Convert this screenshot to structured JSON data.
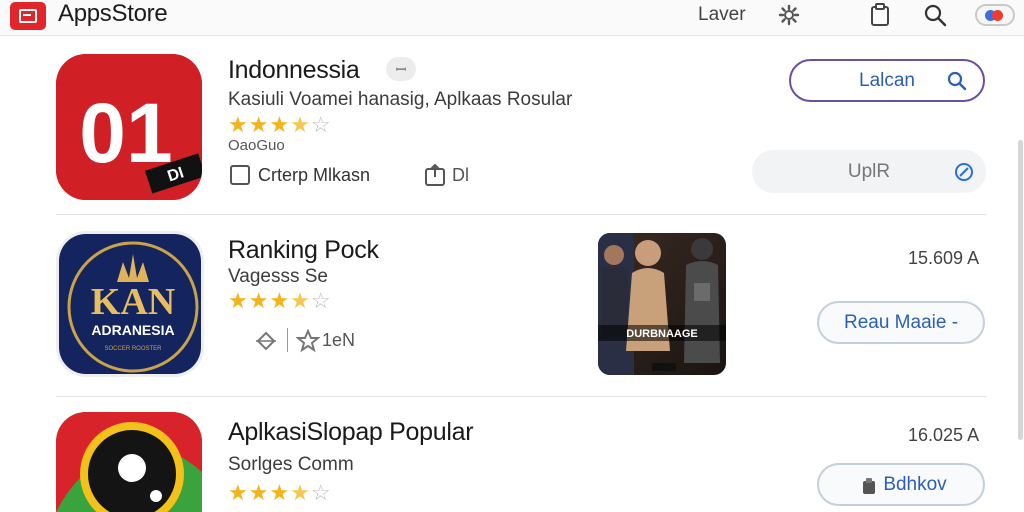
{
  "header": {
    "title": "AppsStore",
    "layer_label": "Laver",
    "icons": [
      "store-logo-icon",
      "gear-icon",
      "clipboard-icon",
      "search-icon",
      "toggle-switch"
    ]
  },
  "apps": [
    {
      "name": "Indonnessia",
      "badge": "ꟷ",
      "subtitle": "Kasiuli  Voamei hanasig, Aplkaas Rosular",
      "rating_stars": 3.5,
      "rating_label": "OaoGuo",
      "checkbox_label": "Crterp Mlkasn",
      "share_label": "Dl",
      "search_button_label": "Lalcan",
      "action_button_label": "UplR"
    },
    {
      "name": "Ranking Pock",
      "subtitle": "Vagesss  Se",
      "rating_stars": 3.5,
      "meta_label": "1eN",
      "screenshot_caption": "DURBNAAGE",
      "size": "15.609 A",
      "button_label": "Reau Maaie -"
    },
    {
      "name": "AplkasiSlopap Popular",
      "subtitle": "Sorlges  Comm",
      "rating_stars": 3.5,
      "size": "16.025 A",
      "button_label": "Bdhkov"
    }
  ],
  "icon_texts": {
    "app1": "01",
    "app1_tag": "DI",
    "app2_line1": "KAN",
    "app2_line2": "ADRANESIA",
    "app2_line3": "SOCCER ROOSTER"
  },
  "colors": {
    "accent_red": "#d8232a",
    "star": "#f2b418",
    "link_blue": "#2b5fb4",
    "outline_purple": "#6b4fa0"
  }
}
